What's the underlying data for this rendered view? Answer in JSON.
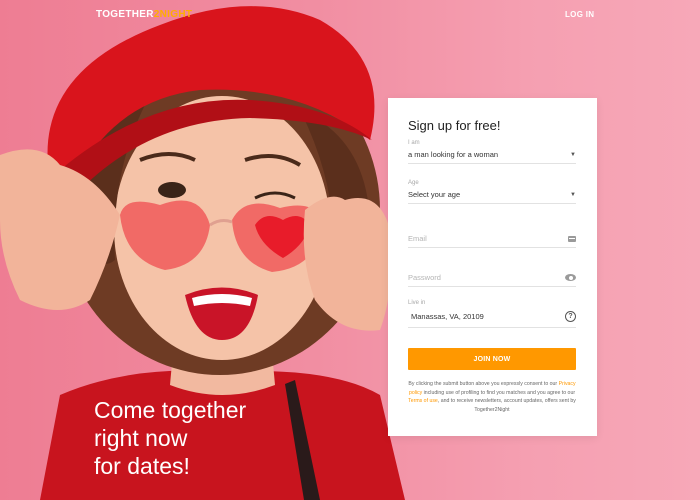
{
  "header": {
    "logo_main": "TOGETHER",
    "logo_accent": "2NIGHT",
    "login_label": "LOG IN"
  },
  "hero": {
    "headline_line1": "Come together",
    "headline_line2": "right now",
    "headline_line3": "for dates!"
  },
  "form": {
    "title": "Sign up for free!",
    "i_am": {
      "label": "I am",
      "value": "a man looking for a woman"
    },
    "age": {
      "label": "Age",
      "value": "Select your age"
    },
    "email": {
      "placeholder": "Email"
    },
    "password": {
      "placeholder": "Password"
    },
    "live_in": {
      "label": "Live in",
      "value": "Manassas, VA, 20109"
    },
    "join_label": "JOIN NOW",
    "disclaimer": {
      "part1": "By clicking the submit button above you expressly consent to our",
      "privacy_link": "Privacy policy",
      "part2": "including use of profiling to find you matches and you agree to our",
      "terms_link": "Terms of use",
      "part3": ", and to receive newsletters, account updates, offers sent by Together2Night"
    }
  },
  "colors": {
    "accent": "#ff9800",
    "background": "#f18ea2",
    "hat": "#d9141c"
  },
  "icons": [
    "dropdown-caret-icon",
    "email-icon",
    "eye-icon",
    "help-icon"
  ]
}
